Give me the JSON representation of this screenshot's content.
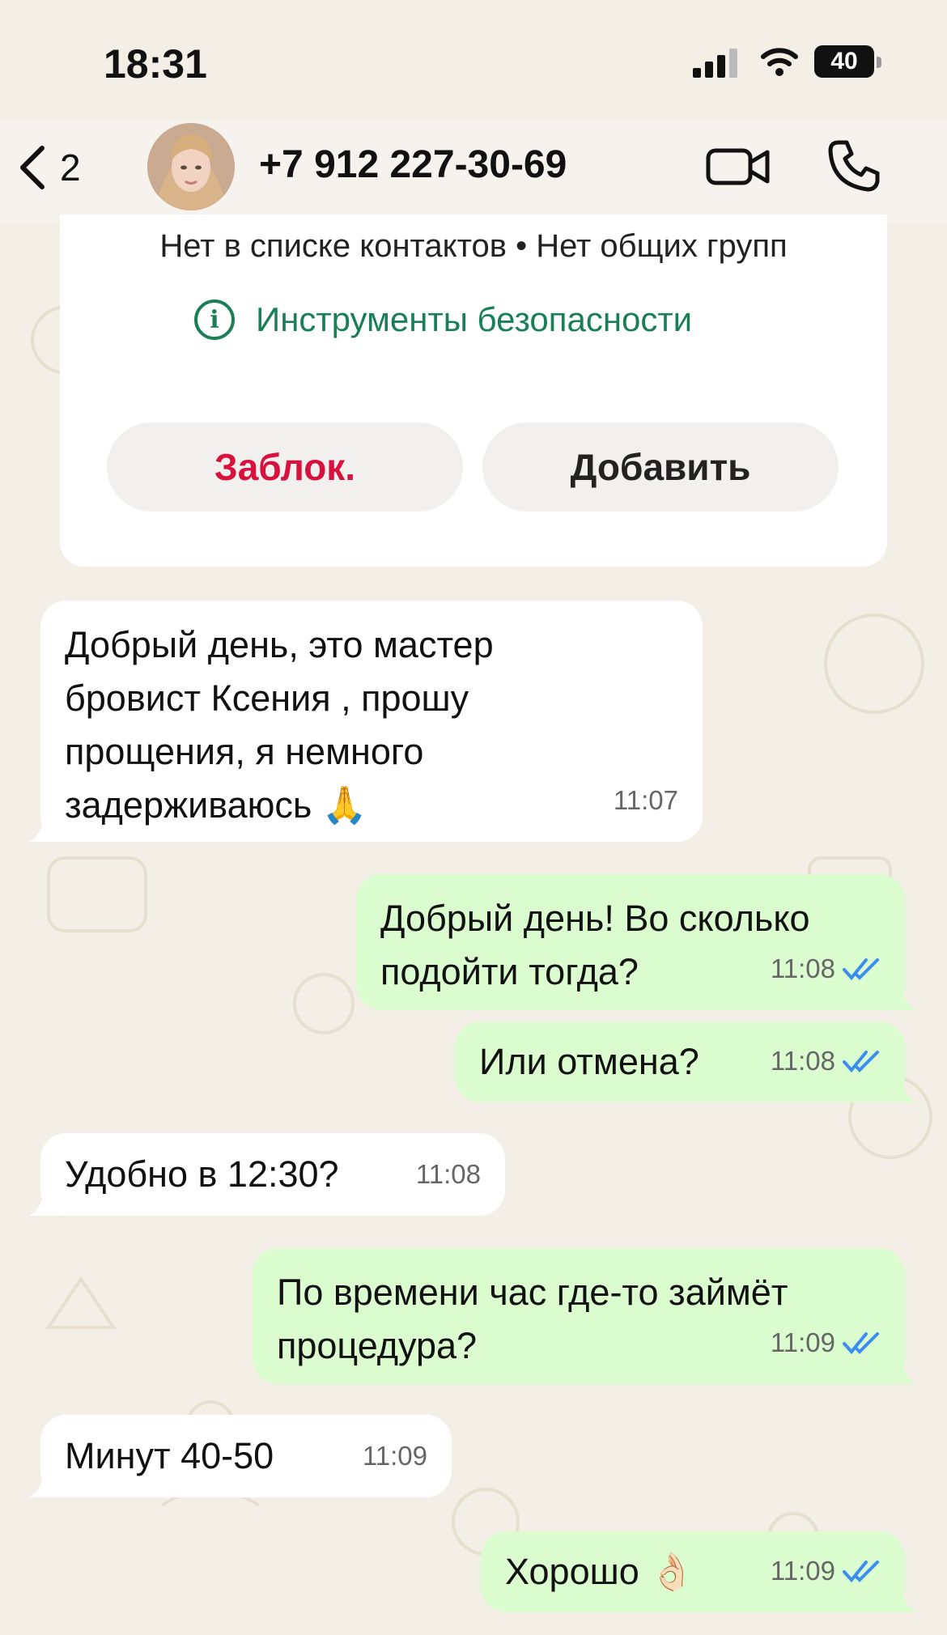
{
  "status_bar": {
    "time": "18:31",
    "battery": "40"
  },
  "header": {
    "back_count": "2",
    "contact_name": "+7 912 227-30-69"
  },
  "info_card": {
    "contact_status": "Нет в списке контактов • Нет общих групп",
    "safety_tools": "Инструменты безопасности",
    "block_label": "Заблок.",
    "add_label": "Добавить"
  },
  "messages": [
    {
      "direction": "in",
      "text": "Добрый день, это мастер\nбровист Ксения , прошу\nпрощения, я немного\nзадерживаюсь 🙏",
      "time": "11:07"
    },
    {
      "direction": "out",
      "text": "Добрый день! Во сколько\nподойти тогда?",
      "time": "11:08",
      "read": true
    },
    {
      "direction": "out",
      "text": "Или отмена?",
      "time": "11:08",
      "read": true
    },
    {
      "direction": "in",
      "text": "Удобно в 12:30?",
      "time": "11:08"
    },
    {
      "direction": "out",
      "text": "По времени час где-то займёт\nпроцедура?",
      "time": "11:09",
      "read": true
    },
    {
      "direction": "in",
      "text": "Минут 40-50",
      "time": "11:09"
    },
    {
      "direction": "out",
      "text": "Хорошо 👌🏻",
      "time": "11:09",
      "read": true
    }
  ],
  "colors": {
    "incoming_bubble": "#ffffff",
    "outgoing_bubble": "#dafccf",
    "read_ticks": "#3b8ef0",
    "safety_green": "#1a7f57",
    "block_red": "#d8113e"
  },
  "icons": [
    "back-chevron-icon",
    "video-call-icon",
    "phone-icon",
    "info-icon",
    "double-check-icon",
    "signal-icon",
    "wifi-icon"
  ]
}
